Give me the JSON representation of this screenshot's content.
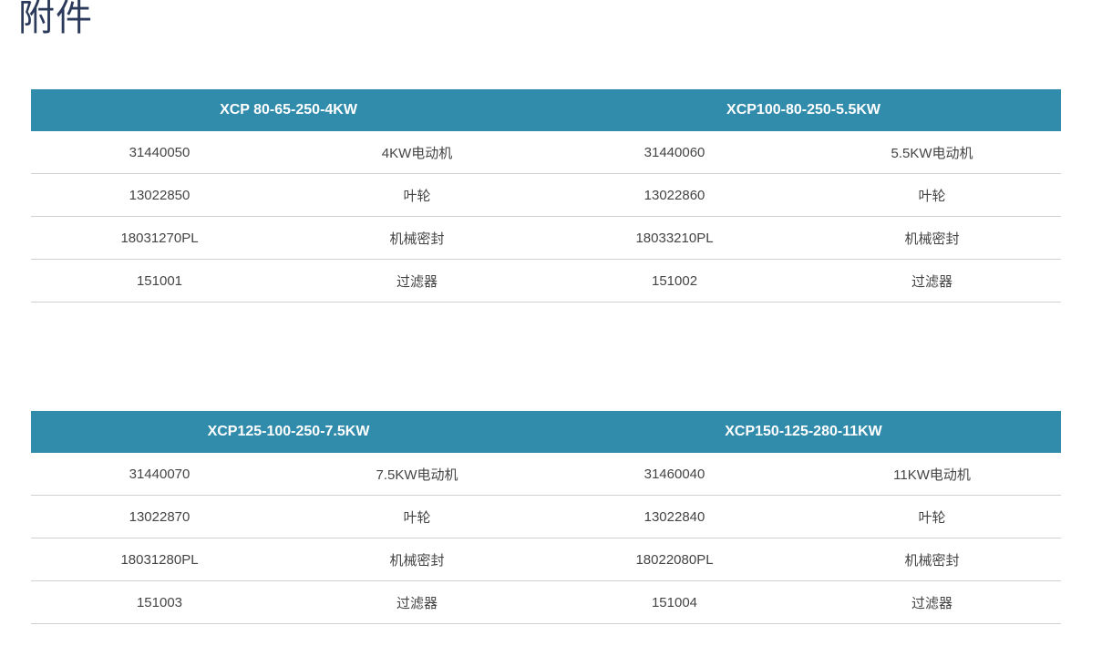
{
  "page": {
    "title": "附件"
  },
  "tables": [
    {
      "groups": [
        {
          "model": "XCP 80-65-250-4KW",
          "rows": [
            {
              "code": "31440050",
              "part": "4KW电动机"
            },
            {
              "code": "13022850",
              "part": "叶轮"
            },
            {
              "code": "18031270PL",
              "part": "机械密封"
            },
            {
              "code": "151001",
              "part": "过滤器"
            }
          ]
        },
        {
          "model": "XCP100-80-250-5.5KW",
          "rows": [
            {
              "code": "31440060",
              "part": "5.5KW电动机"
            },
            {
              "code": "13022860",
              "part": "叶轮"
            },
            {
              "code": "18033210PL",
              "part": "机械密封"
            },
            {
              "code": "151002",
              "part": "过滤器"
            }
          ]
        }
      ]
    },
    {
      "groups": [
        {
          "model": "XCP125-100-250-7.5KW",
          "rows": [
            {
              "code": "31440070",
              "part": "7.5KW电动机"
            },
            {
              "code": "13022870",
              "part": "叶轮"
            },
            {
              "code": "18031280PL",
              "part": "机械密封"
            },
            {
              "code": "151003",
              "part": "过滤器"
            }
          ]
        },
        {
          "model": "XCP150-125-280-11KW",
          "rows": [
            {
              "code": "31460040",
              "part": "11KW电动机"
            },
            {
              "code": "13022840",
              "part": "叶轮"
            },
            {
              "code": "18022080PL",
              "part": "机械密封"
            },
            {
              "code": "151004",
              "part": "过滤器"
            }
          ]
        }
      ]
    }
  ]
}
